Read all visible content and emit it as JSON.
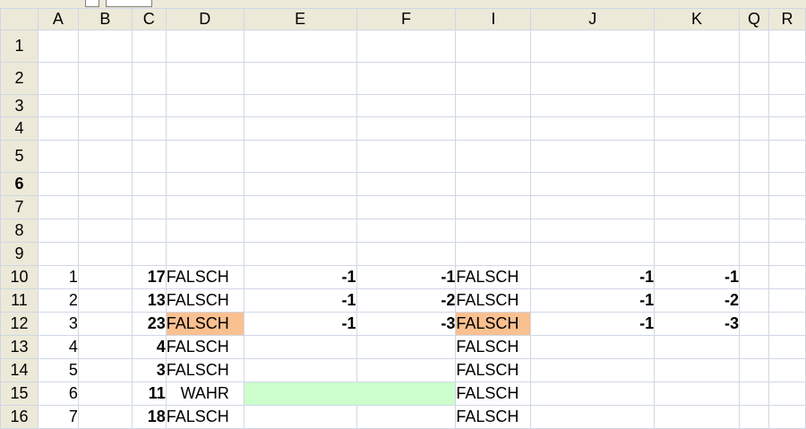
{
  "columns": [
    "A",
    "B",
    "C",
    "D",
    "E",
    "F",
    "I",
    "J",
    "K",
    "Q",
    "R"
  ],
  "rows": [
    {
      "label": "1",
      "cells": {}
    },
    {
      "label": "2",
      "cells": {}
    },
    {
      "label": "3",
      "cells": {}
    },
    {
      "label": "4",
      "cells": {}
    },
    {
      "label": "5",
      "cells": {}
    },
    {
      "label": "6",
      "cells": {}
    },
    {
      "label": "7",
      "cells": {}
    },
    {
      "label": "8",
      "cells": {}
    },
    {
      "label": "9",
      "cells": {}
    },
    {
      "label": "10",
      "cells": {
        "A": "1",
        "C": "17",
        "D": "FALSCH",
        "E": "-1",
        "F": "-1",
        "I": "FALSCH",
        "J": "-1",
        "K": "-1"
      }
    },
    {
      "label": "11",
      "cells": {
        "A": "2",
        "C": "13",
        "D": "FALSCH",
        "E": "-1",
        "F": "-2",
        "I": "FALSCH",
        "J": "-1",
        "K": "-2"
      }
    },
    {
      "label": "12",
      "cells": {
        "A": "3",
        "C": "23",
        "D": "FALSCH",
        "E": "-1",
        "F": "-3",
        "I": "FALSCH",
        "J": "-1",
        "K": "-3"
      }
    },
    {
      "label": "13",
      "cells": {
        "A": "4",
        "C": "4",
        "D": "FALSCH",
        "I": "FALSCH"
      }
    },
    {
      "label": "14",
      "cells": {
        "A": "5",
        "C": "3",
        "D": "FALSCH",
        "I": "FALSCH"
      }
    },
    {
      "label": "15",
      "cells": {
        "A": "6",
        "C": "11",
        "D": "WAHR",
        "I": "FALSCH"
      }
    },
    {
      "label": "16",
      "cells": {
        "A": "7",
        "C": "18",
        "D": "FALSCH",
        "I": "FALSCH"
      }
    }
  ],
  "active_row": "6",
  "highlight_colors": {
    "orange": "#fac090",
    "green": "#ccffcc",
    "red_text": "#e00000"
  }
}
